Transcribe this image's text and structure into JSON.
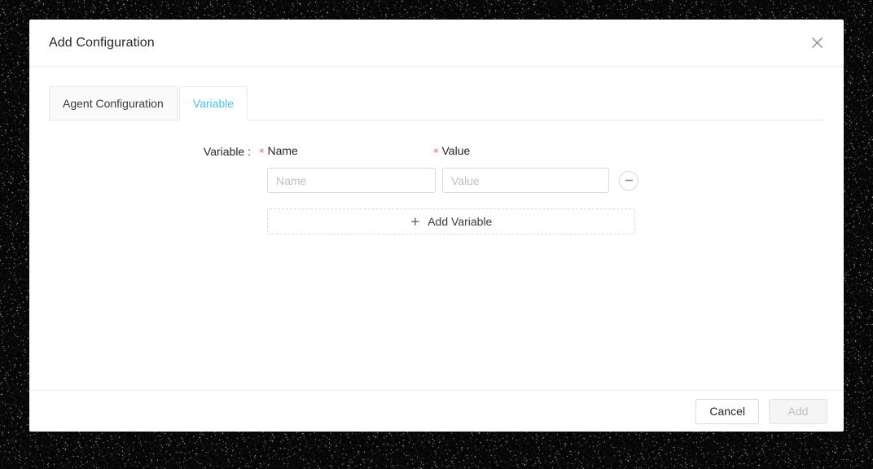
{
  "dialog": {
    "title": "Add Configuration",
    "close_icon": "close-icon"
  },
  "tabs": [
    {
      "label": "Agent Configuration",
      "active": false
    },
    {
      "label": "Variable",
      "active": true
    }
  ],
  "form": {
    "section_label": "Variable :",
    "required_marker": "*",
    "columns": {
      "name_header": "Name",
      "value_header": "Value"
    },
    "rows": [
      {
        "name_value": "",
        "name_placeholder": "Name",
        "value_value": "",
        "value_placeholder": "Value",
        "remove_icon": "minus-circle-icon"
      }
    ],
    "add_variable": {
      "plus_icon": "plus-icon",
      "label": "Add Variable"
    }
  },
  "footer": {
    "cancel_label": "Cancel",
    "add_label": "Add",
    "add_disabled": true
  },
  "colors": {
    "accent_blue": "#4cc2ef",
    "required_red": "#f5606b",
    "border": "#d9d9d9",
    "divider": "#eeeeee",
    "placeholder": "#bfbfbf",
    "backdrop": "#000000"
  }
}
